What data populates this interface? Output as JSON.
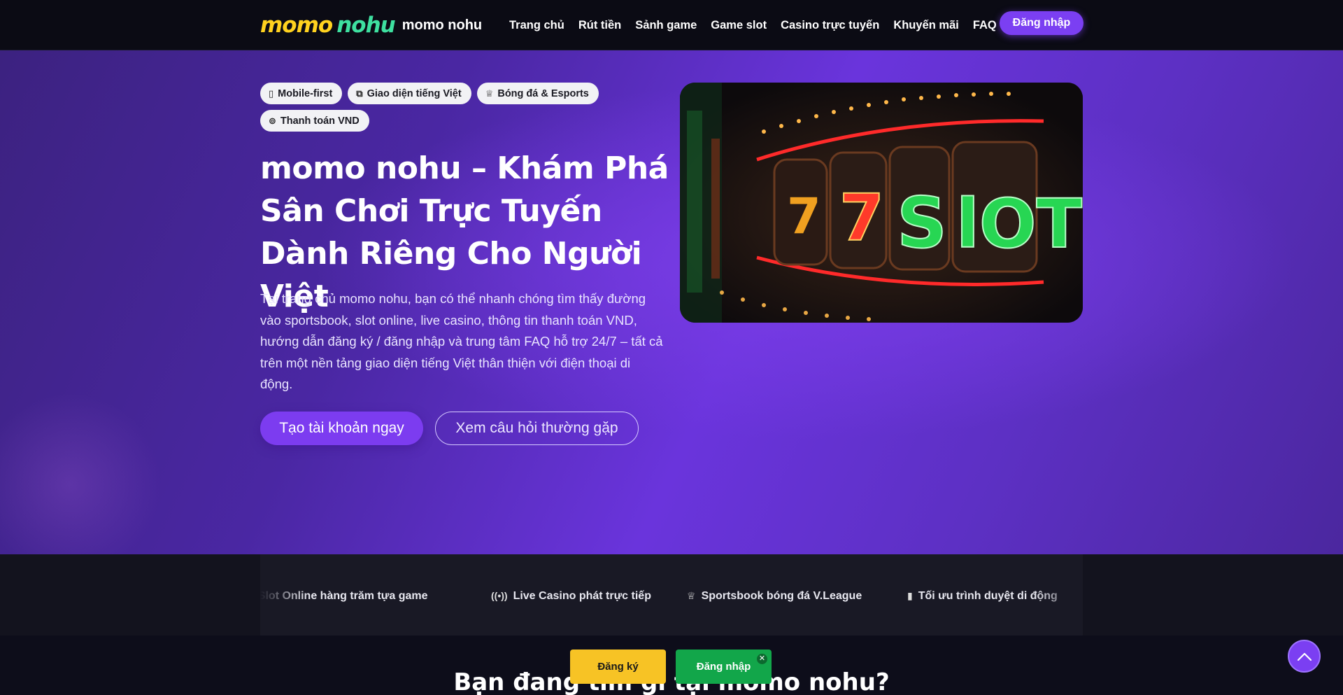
{
  "header": {
    "logo_word1": "momo",
    "logo_word2": "nohu",
    "site_name": "momo nohu",
    "nav": [
      {
        "label": "Trang chủ"
      },
      {
        "label": "Rút tiền"
      },
      {
        "label": "Sảnh game"
      },
      {
        "label": "Game slot"
      },
      {
        "label": "Casino trực tuyến"
      },
      {
        "label": "Khuyến mãi"
      },
      {
        "label": "FAQ"
      }
    ],
    "login_label": "Đăng nhập"
  },
  "hero": {
    "chips": [
      {
        "icon": "mobile-icon",
        "label": "Mobile-first"
      },
      {
        "icon": "language-icon",
        "label": "Giao diện tiếng Việt"
      },
      {
        "icon": "trophy-icon",
        "label": "Bóng đá & Esports"
      },
      {
        "icon": "coins-icon",
        "label": "Thanh toán VND"
      }
    ],
    "title": "momo nohu – Khám Phá Sân Chơi Trực Tuyến Dành Riêng Cho Người Việt",
    "description": "Tại trang chủ momo nohu, bạn có thể nhanh chóng tìm thấy đường vào sportsbook, slot online, live casino, thông tin thanh toán VND, hướng dẫn đăng ký / đăng nhập và trung tâm FAQ hỗ trợ 24/7 – tất cả trên một nền tảng giao diện tiếng Việt thân thiện với điện thoại di động.",
    "cta_primary": "Tạo tài khoản ngay",
    "cta_secondary": "Xem câu hỏi thường gặp",
    "image_text": "7 SlOT"
  },
  "ticker": {
    "items": [
      {
        "icon": "slot-icon",
        "label": "Slot Online hàng trăm tựa game"
      },
      {
        "icon": "broadcast-icon",
        "label": "Live Casino phát trực tiếp"
      },
      {
        "icon": "trophy-icon",
        "label": "Sportsbook bóng đá V.League"
      },
      {
        "icon": "mobile-icon",
        "label": "Tối ưu trình duyệt di động"
      }
    ]
  },
  "section": {
    "title": "Bạn đang tìm gì tại momo nohu?"
  },
  "sticky": {
    "register_label": "Đăng ký",
    "login_label": "Đăng nhập",
    "close_icon": "close-icon"
  },
  "colors": {
    "accent": "#7b3ff2",
    "register": "#f7c325",
    "login": "#12a64a"
  }
}
